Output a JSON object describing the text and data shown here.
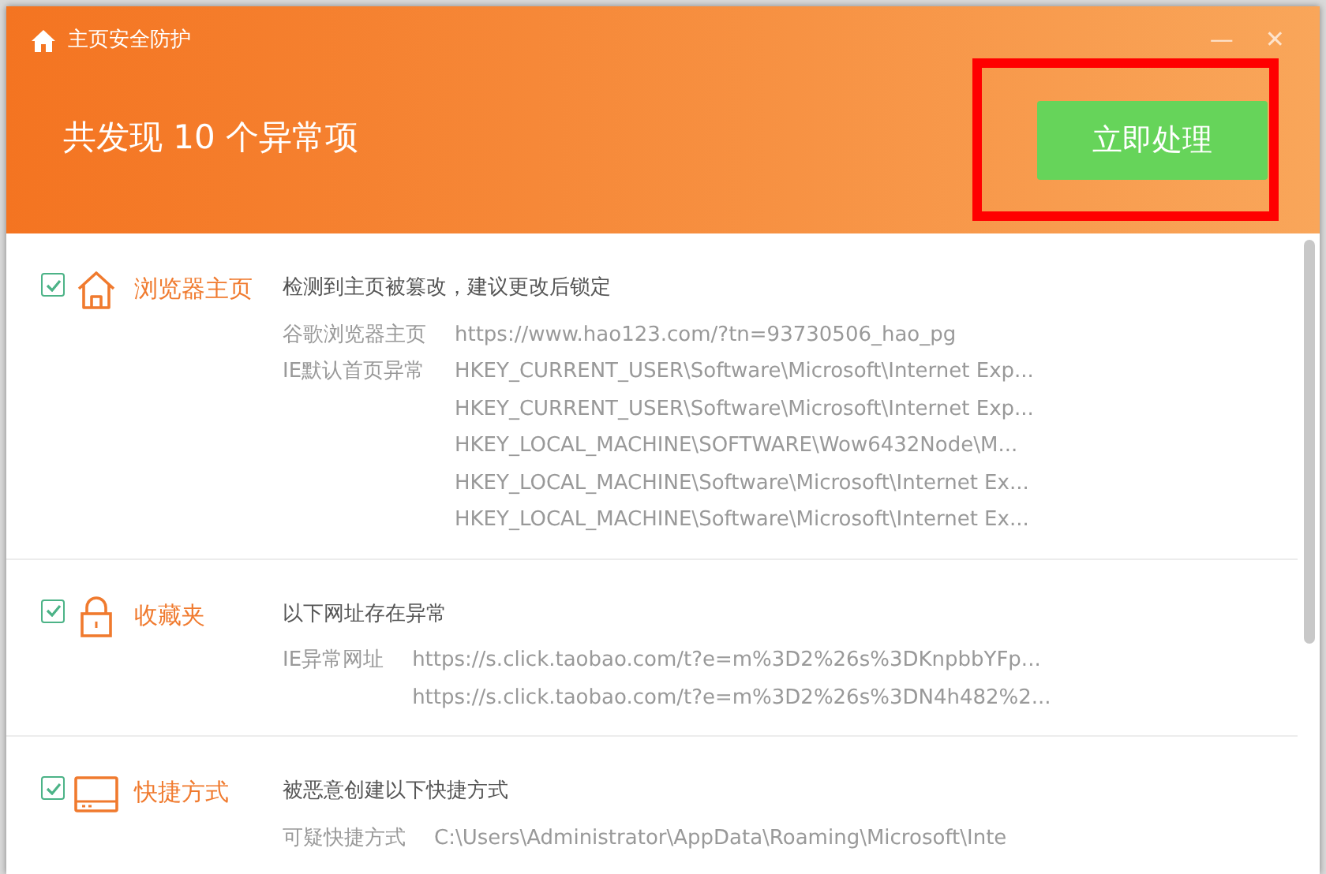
{
  "window": {
    "title": "主页安全防护",
    "minimize": "—",
    "close": "✕"
  },
  "header": {
    "headline": "共发现 10 个异常项",
    "action_button": "立即处理"
  },
  "items": [
    {
      "kind": "home",
      "checked": true,
      "title": "浏览器主页",
      "description": "检测到主页被篡改，建议更改后锁定",
      "details": [
        {
          "label": "谷歌浏览器主页",
          "values": [
            "https://www.hao123.com/?tn=93730506_hao_pg"
          ]
        },
        {
          "label": "IE默认首页异常",
          "values": [
            "HKEY_CURRENT_USER\\Software\\Microsoft\\Internet Exp...",
            "HKEY_CURRENT_USER\\Software\\Microsoft\\Internet Exp...",
            "HKEY_LOCAL_MACHINE\\SOFTWARE\\Wow6432Node\\M...",
            "HKEY_LOCAL_MACHINE\\Software\\Microsoft\\Internet Ex...",
            "HKEY_LOCAL_MACHINE\\Software\\Microsoft\\Internet Ex..."
          ]
        }
      ]
    },
    {
      "kind": "lock",
      "checked": true,
      "title": "收藏夹",
      "description": "以下网址存在异常",
      "details": [
        {
          "label": "IE异常网址",
          "values": [
            "https://s.click.taobao.com/t?e=m%3D2%26s%3DKnpbbYFp...",
            "https://s.click.taobao.com/t?e=m%3D2%26s%3DN4h482%2..."
          ]
        }
      ]
    },
    {
      "kind": "window",
      "checked": true,
      "title": "快捷方式",
      "description": "被恶意创建以下快捷方式",
      "details": [
        {
          "label": "可疑快捷方式",
          "values": [
            "C:\\Users\\Administrator\\AppData\\Roaming\\Microsoft\\Inte"
          ]
        }
      ]
    }
  ]
}
